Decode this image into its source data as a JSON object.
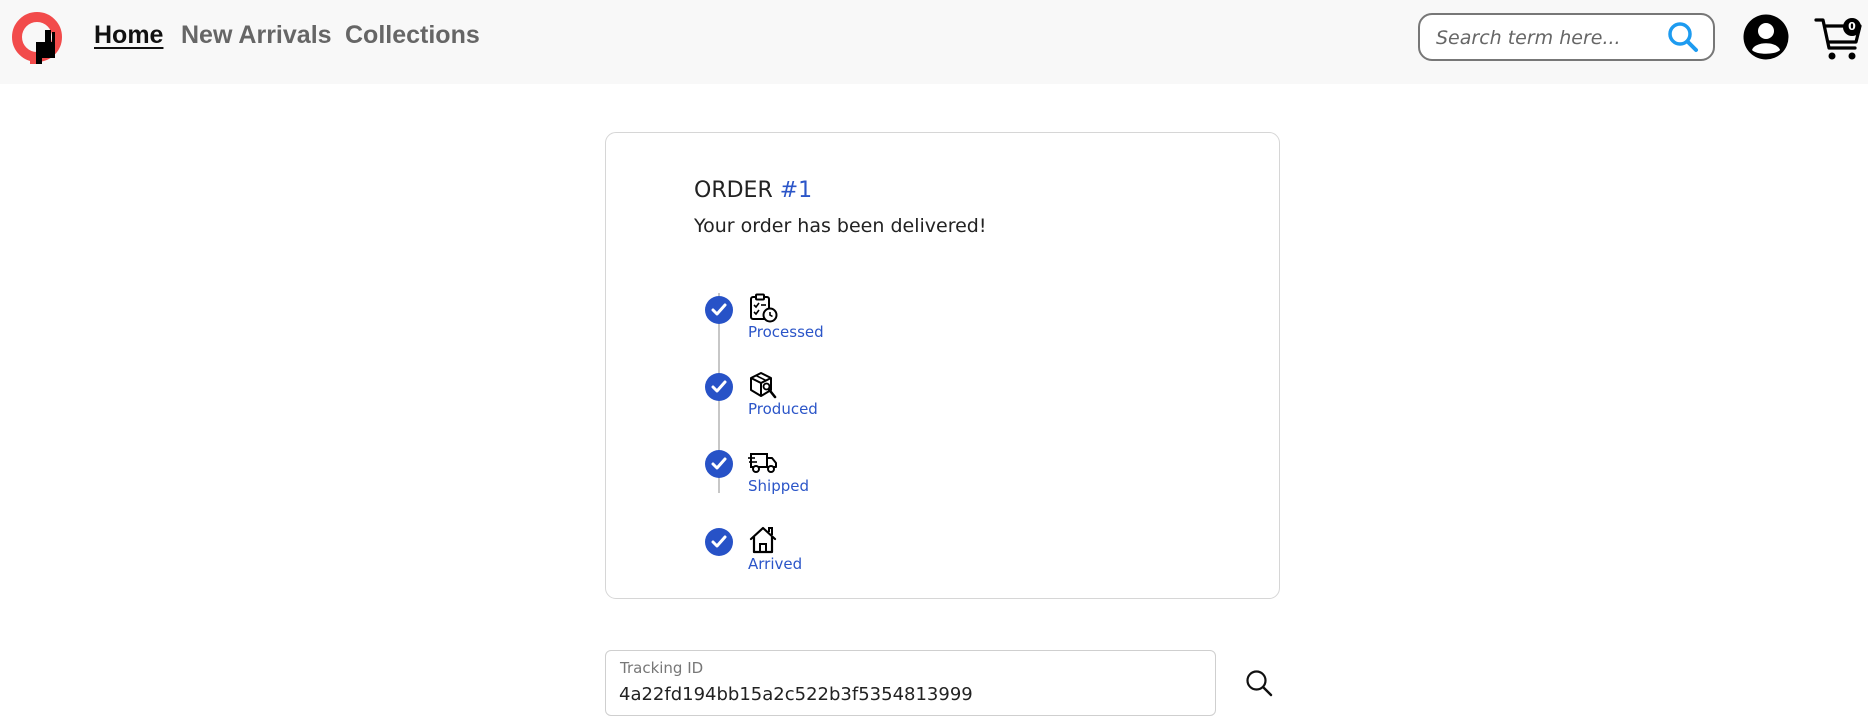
{
  "nav": {
    "links": [
      {
        "label": "Home",
        "active": true
      },
      {
        "label": "New Arrivals",
        "active": false
      },
      {
        "label": "Collections",
        "active": false
      }
    ],
    "search_placeholder": "Search term here...",
    "cart_count": "0"
  },
  "order": {
    "title_prefix": "ORDER",
    "number": "#1",
    "message": "Your order has been delivered!",
    "steps": [
      {
        "label": "Processed",
        "icon": "clipboard-clock-icon",
        "completed": true
      },
      {
        "label": "Produced",
        "icon": "box-wrench-icon",
        "completed": true
      },
      {
        "label": "Shipped",
        "icon": "truck-icon",
        "completed": true
      },
      {
        "label": "Arrived",
        "icon": "house-icon",
        "completed": true
      }
    ]
  },
  "tracking": {
    "label": "Tracking ID",
    "value": "4a22fd194bb15a2c522b3f5354813999"
  },
  "colors": {
    "accent": "#2752c7",
    "search_accent": "#1d9bf0",
    "logo_red": "#f24b4b"
  }
}
